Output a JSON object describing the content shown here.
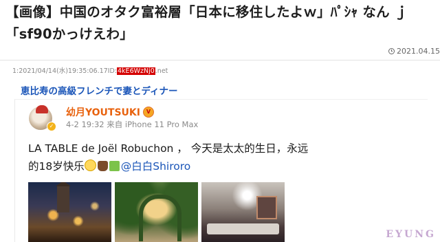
{
  "article": {
    "title": "【画像】中国のオタク富裕層「日本に移住したよｗ」ﾊﾟｼｬ なん ｊ「sf90かっけえわ」",
    "date": "2021.04.15",
    "post_header": {
      "prefix": "1:2021/04/14(水)19:35:06.17ID:",
      "id": "4kE6WzNj0",
      "suffix": ".net"
    },
    "quote_link": "恵比寿の高級フレンチで妻とディナー"
  },
  "weibo_post": {
    "username": "幼月YOUTSUKI",
    "meta": "4-2 19:32 来自 iPhone 11 Pro Max",
    "text": "LA TABLE de Joël Robuchon ， 今天是太太的生日，永远的18岁快乐",
    "mention": "@白白Shiroro",
    "photos": [
      "night-building-photo",
      "garden-arch-photo",
      "dining-room-photo"
    ]
  },
  "watermark": {
    "top": "",
    "bottom": "EYUNG"
  },
  "colors": {
    "link": "#1a55b8",
    "username": "#e8620e",
    "id_highlight": "#d40000"
  },
  "icons": {
    "date": "clock-icon",
    "verified": "verified-badge-icon",
    "vip": "vip-badge-icon"
  }
}
